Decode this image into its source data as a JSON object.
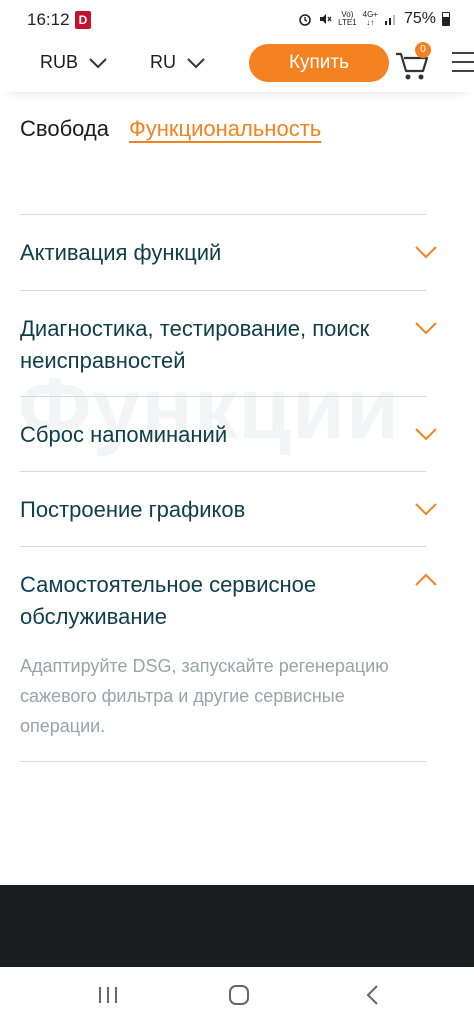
{
  "status_bar": {
    "time": "16:12",
    "app_badge": "D",
    "net_top": "Vo)",
    "net_bottom": "LTE1",
    "net_gen": "4G+",
    "battery": "75%"
  },
  "header": {
    "currency": "RUB",
    "language": "RU",
    "buy_label": "Купить",
    "cart_count": "0"
  },
  "tabs": [
    {
      "label": "Свобода",
      "active": false
    },
    {
      "label": "Функциональность",
      "active": true
    }
  ],
  "watermark": "Функции",
  "accordion": [
    {
      "title": "Активация функций",
      "expanded": false
    },
    {
      "title": "Диагностика, тестирование, поиск неисправностей",
      "expanded": false
    },
    {
      "title": "Сброс напоминаний",
      "expanded": false
    },
    {
      "title": "Построение графиков",
      "expanded": false
    },
    {
      "title": "Самостоятельное сервисное обслуживание",
      "expanded": true,
      "body": "Адаптируйте DSG, запускайте регенерацию сажевого фильтра и другие сервисные операции."
    }
  ],
  "colors": {
    "accent": "#f58220",
    "text_primary": "#0f3d4a",
    "text_muted": "#9aa3a8",
    "footer": "#1b1d21"
  }
}
